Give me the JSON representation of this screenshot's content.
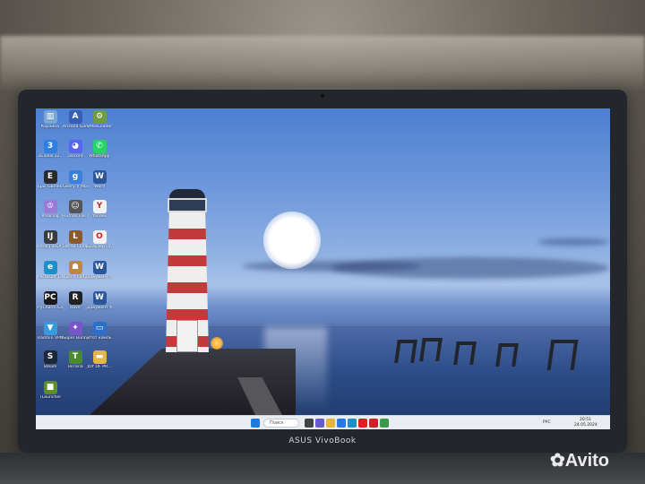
{
  "desktop": {
    "icons": [
      {
        "label": "Корзина",
        "color": "#7aa6d6",
        "glyph": "▥",
        "icon": "recycle-bin-icon"
      },
      {
        "label": "Arizona Games",
        "color": "#3560b3",
        "glyph": "A",
        "icon": "arizona-icon"
      },
      {
        "label": "VMosLoader",
        "color": "#6f9b44",
        "glyph": "⚙",
        "icon": "vmos-icon"
      },
      {
        "label": "3uTools 32...",
        "color": "#2f7fe0",
        "glyph": "3",
        "icon": "3utools-icon"
      },
      {
        "label": "Discord",
        "color": "#5865f2",
        "glyph": "◕",
        "icon": "discord-icon"
      },
      {
        "label": "WhatsApp",
        "color": "#25d366",
        "glyph": "✆",
        "icon": "whatsapp-icon"
      },
      {
        "label": "Epic Games Launcher",
        "color": "#2a2a2a",
        "glyph": "E",
        "icon": "epic-games-icon"
      },
      {
        "label": "Genry V Mod",
        "color": "#3a7fd9",
        "glyph": "g",
        "icon": "genry-icon"
      },
      {
        "label": "Word",
        "color": "#2b579a",
        "glyph": "W",
        "icon": "word-icon"
      },
      {
        "label": "#Racing",
        "color": "#9c7bd8",
        "glyph": "♔",
        "icon": "racing-icon"
      },
      {
        "label": "Human Fall Flat Steam",
        "color": "#555",
        "glyph": "☺",
        "icon": "human-fall-flat-icon"
      },
      {
        "label": "Yandex",
        "color": "#f2f2f2",
        "glyph": "Y",
        "icon": "yandex-icon"
      },
      {
        "label": "IntelliJ IDEA Communit...",
        "color": "#3b3b3b",
        "glyph": "IJ",
        "icon": "intellij-icon"
      },
      {
        "label": "Lethal Company",
        "color": "#8a5a2b",
        "glyph": "L",
        "icon": "lethal-company-icon"
      },
      {
        "label": "Браузер Opera",
        "color": "#f2f2f2",
        "glyph": "O",
        "icon": "opera-icon"
      },
      {
        "label": "Microsoft Edge",
        "color": "#1e90c8",
        "glyph": "e",
        "icon": "edge-icon"
      },
      {
        "label": "Lunch Lady",
        "color": "#b88a3a",
        "glyph": "☗",
        "icon": "lunch-lady-icon"
      },
      {
        "label": "Документ Microsof...",
        "color": "#2b579a",
        "glyph": "W",
        "icon": "word-doc-icon"
      },
      {
        "label": "PyCharm Commun...",
        "color": "#1a1a1a",
        "glyph": "PC",
        "icon": "pycharm-icon"
      },
      {
        "label": "Rave",
        "color": "#222",
        "glyph": "R",
        "icon": "rave-icon"
      },
      {
        "label": "Документ Microsof...",
        "color": "#2b579a",
        "glyph": "W",
        "icon": "word-doc-icon"
      },
      {
        "label": "Radmin VPN",
        "color": "#3a9ad9",
        "glyph": "▼",
        "icon": "radmin-vpn-icon"
      },
      {
        "label": "Super Bunny Man",
        "color": "#7a55c8",
        "glyph": "✦",
        "icon": "super-bunny-man-icon"
      },
      {
        "label": "Этот компьюте...",
        "color": "#2b6fc6",
        "glyph": "▭",
        "icon": "this-pc-icon"
      },
      {
        "label": "Steam",
        "color": "#1b2838",
        "glyph": "S",
        "icon": "steam-icon"
      },
      {
        "label": "Terraria",
        "color": "#4c8a2f",
        "glyph": "T",
        "icon": "terraria-icon"
      },
      {
        "label": "JOY OF PR...",
        "color": "#e3b64a",
        "glyph": "▬",
        "icon": "folder-icon"
      },
      {
        "label": "TLauncher",
        "color": "#5c8f2c",
        "glyph": "■",
        "icon": "tlauncher-icon"
      }
    ]
  },
  "taskbar": {
    "search_placeholder": "Поиск",
    "language": "РУС",
    "time": "20:51",
    "date": "24.05.2024",
    "apps": [
      {
        "icon": "start-icon",
        "color": "#1f7ae0"
      },
      {
        "icon": "task-view-icon",
        "color": "#444"
      },
      {
        "icon": "chat-icon",
        "color": "#6a5acd"
      },
      {
        "icon": "explorer-icon",
        "color": "#e8b339"
      },
      {
        "icon": "store-icon",
        "color": "#2b78e4"
      },
      {
        "icon": "edge-taskbar-icon",
        "color": "#1e90c8"
      },
      {
        "icon": "yandex-taskbar-icon",
        "color": "#e02020"
      },
      {
        "icon": "opera-taskbar-icon",
        "color": "#d0202a"
      },
      {
        "icon": "chrome-taskbar-icon",
        "color": "#3a9a4a"
      }
    ]
  },
  "laptop": {
    "brand": "ASUS VivoBook"
  },
  "watermark": {
    "text": "Avito"
  }
}
